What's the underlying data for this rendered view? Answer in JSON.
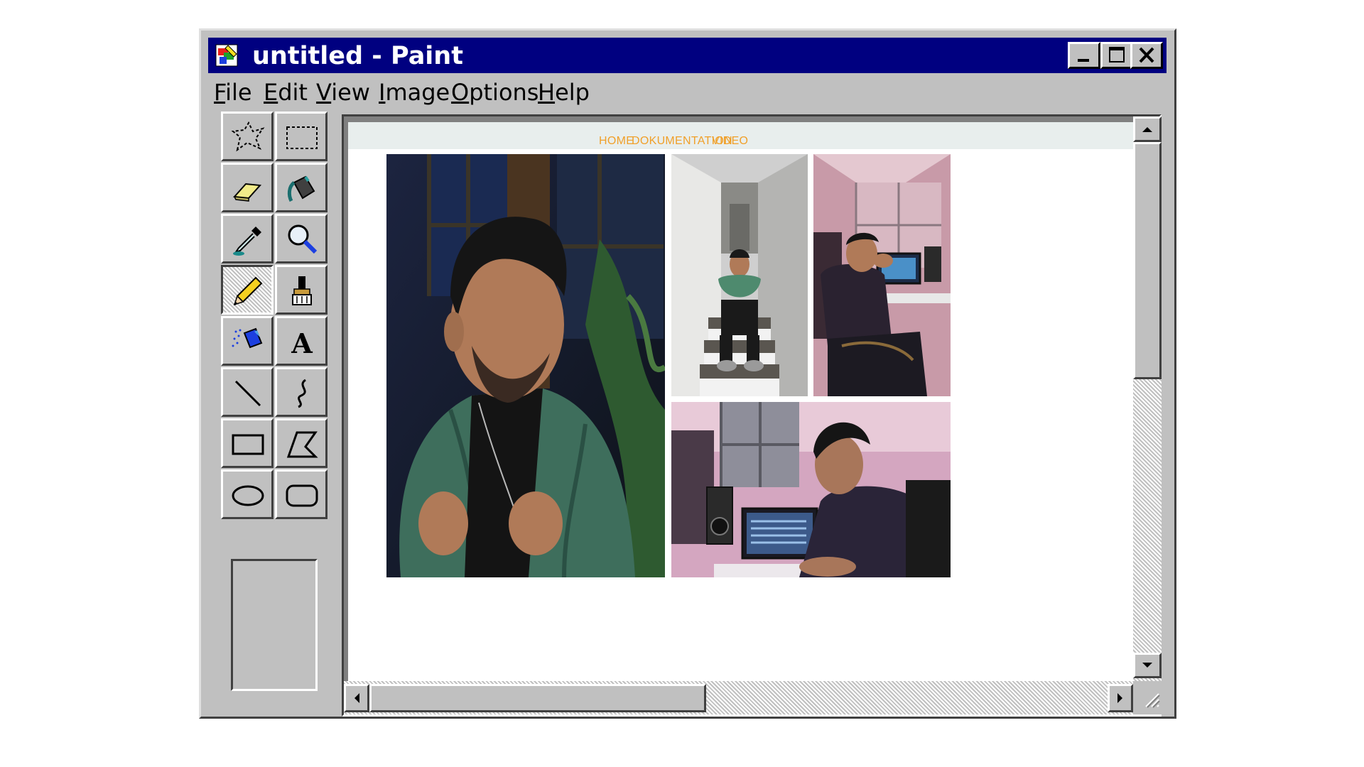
{
  "window": {
    "title": "untitled - Paint"
  },
  "menu": [
    {
      "key": "F",
      "rest": "ile"
    },
    {
      "key": "E",
      "rest": "dit"
    },
    {
      "key": "V",
      "rest": "iew"
    },
    {
      "key": "I",
      "rest": "mage"
    },
    {
      "key": "O",
      "rest": "ptions"
    },
    {
      "key": "H",
      "rest": "elp"
    }
  ],
  "tools": [
    "free-form-select",
    "select",
    "eraser",
    "fill-with-color",
    "pick-color",
    "magnifier",
    "pencil",
    "brush",
    "airbrush",
    "text",
    "line",
    "curve",
    "rectangle",
    "polygon",
    "ellipse",
    "rounded-rectangle"
  ],
  "active_tool": "pencil",
  "page": {
    "nav": [
      "HOME",
      "DOKUMENTATION",
      "VIDEO"
    ],
    "nav_color": "#f0a02a"
  },
  "colors": {
    "title_bar": "#000080",
    "face": "#c0c0c0"
  }
}
